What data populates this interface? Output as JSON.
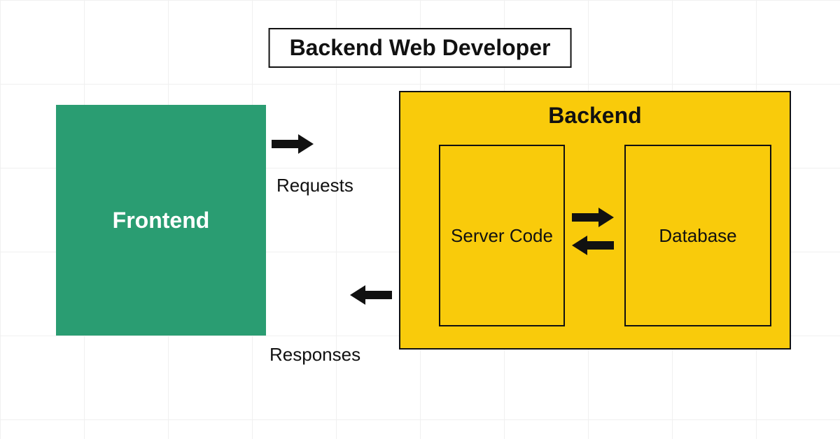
{
  "title": "Backend Web Developer",
  "frontend": {
    "label": "Frontend"
  },
  "backend": {
    "label": "Backend",
    "server": "Server Code",
    "database": "Database"
  },
  "flow": {
    "requests": "Requests",
    "responses": "Responses"
  }
}
